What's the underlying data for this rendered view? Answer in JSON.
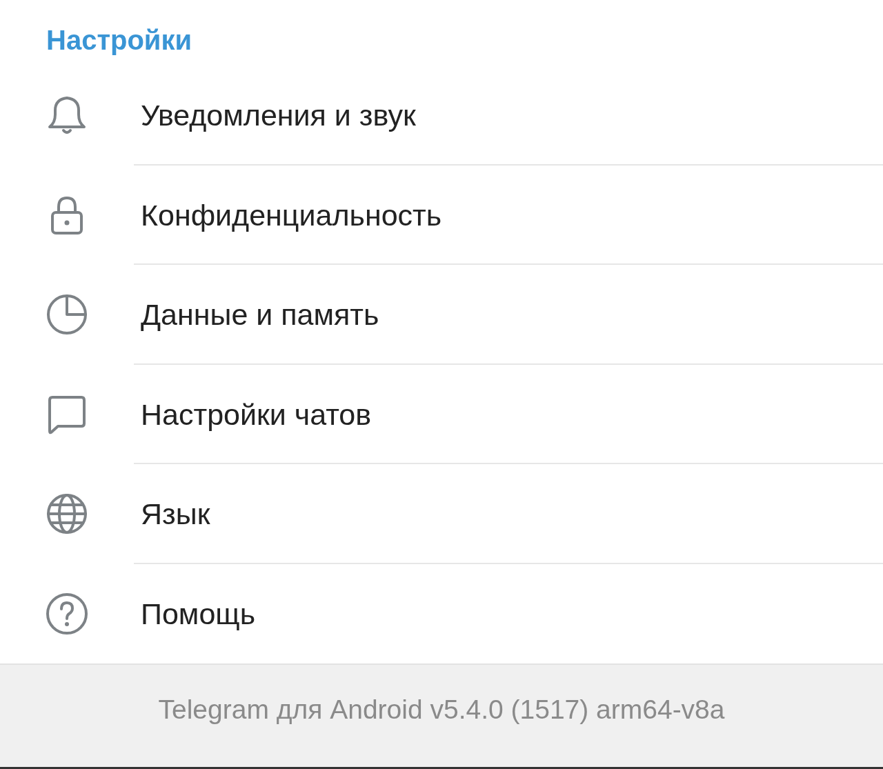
{
  "header": {
    "title": "Настройки"
  },
  "items": [
    {
      "kind": "bell",
      "label": "Уведомления и звук"
    },
    {
      "kind": "lock",
      "label": "Конфиденциальность"
    },
    {
      "kind": "pie",
      "label": "Данные и память"
    },
    {
      "kind": "chat",
      "label": "Настройки чатов"
    },
    {
      "kind": "globe",
      "label": "Язык"
    },
    {
      "kind": "help",
      "label": "Помощь"
    }
  ],
  "footer": {
    "text": "Telegram для Android v5.4.0 (1517) arm64-v8a"
  }
}
